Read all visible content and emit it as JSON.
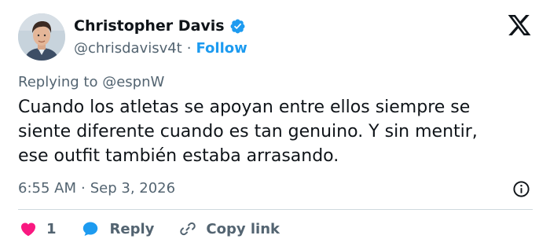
{
  "author": {
    "display_name": "Christopher Davis",
    "handle": "@chrisdavisv4t",
    "separator": "·",
    "follow_label": "Follow",
    "verified": true,
    "avatar_icon": "person-photo"
  },
  "reply_context": {
    "prefix": "Replying to",
    "mention": "@espnW"
  },
  "tweet": {
    "lines": [
      "Cuando los atletas se apoyan entre ellos siempre se",
      "siente diferente cuando es tan genuino. Y sin mentir,",
      "ese outfit también estaba arrasando."
    ]
  },
  "meta": {
    "time": "6:55 AM",
    "separator": "·",
    "date": "Sep 3, 2026"
  },
  "actions": {
    "like_count": "1",
    "reply_label": "Reply",
    "copy_link_label": "Copy link"
  },
  "colors": {
    "accent": "#1d9bf0",
    "like": "#f91880",
    "text": "#0f1419",
    "secondary": "#536471",
    "divider": "#cfd9de"
  },
  "icons": {
    "brand": "x-logo-icon",
    "verified": "verified-badge-icon",
    "info": "info-icon",
    "like": "heart-icon",
    "reply": "reply-bubble-icon",
    "copy": "link-icon"
  }
}
